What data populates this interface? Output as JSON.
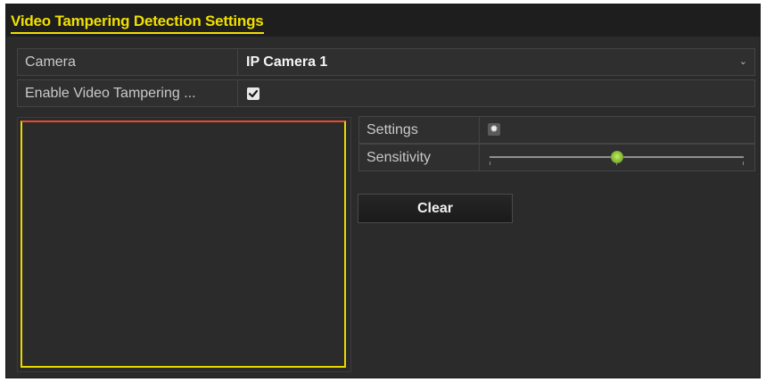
{
  "window": {
    "title": "Video Tampering Detection Settings"
  },
  "camera": {
    "label": "Camera",
    "value": "IP Camera 1",
    "dropdown_icon": "chevron-down-icon"
  },
  "enable_tampering": {
    "label": "Enable Video Tampering ...",
    "checked": true
  },
  "settings": {
    "label": "Settings",
    "icon": "gear-icon"
  },
  "sensitivity": {
    "label": "Sensitivity",
    "level_fraction": 0.5
  },
  "actions": {
    "clear_label": "Clear"
  },
  "colors": {
    "title": "#f0e000",
    "region_border": "#e8d800",
    "region_top_border": "#e64b2a",
    "panel_background": "#2b2b2b",
    "slider_thumb": "#8fc43a"
  }
}
